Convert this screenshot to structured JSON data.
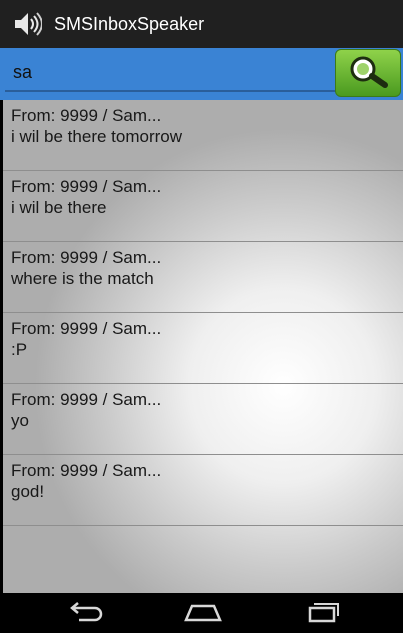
{
  "app": {
    "title": "SMSInboxSpeaker",
    "icon": "speaker-icon"
  },
  "search": {
    "value": "sa",
    "button_icon": "search-icon"
  },
  "messages": [
    {
      "from": "From:  9999 / Sam...",
      "body": "i wil be there tomorrow"
    },
    {
      "from": "From:  9999 / Sam...",
      "body": "i wil be there"
    },
    {
      "from": "From:  9999 / Sam...",
      "body": "where is the match"
    },
    {
      "from": "From:  9999 / Sam...",
      "body": ":P"
    },
    {
      "from": "From:  9999 / Sam...",
      "body": "yo"
    },
    {
      "from": "From:  9999 / Sam...",
      "body": "god!"
    }
  ],
  "navbar": {
    "back_icon": "back-icon",
    "home_icon": "home-icon",
    "recents_icon": "recents-icon"
  },
  "colors": {
    "action_bar": "#202020",
    "search_row": "#3a83d4",
    "search_button": "#6cb832"
  }
}
